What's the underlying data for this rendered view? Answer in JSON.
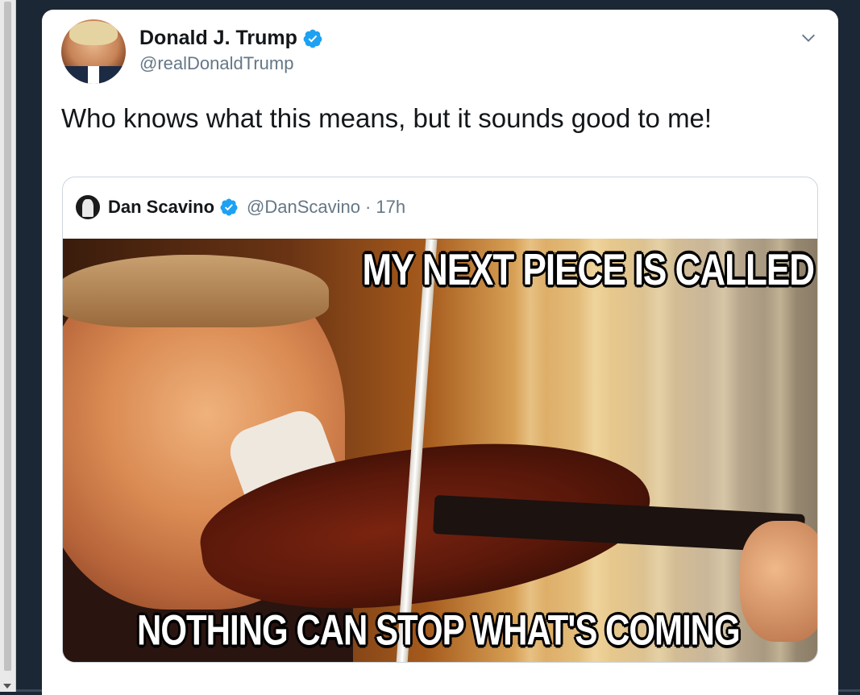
{
  "tweet": {
    "author_name": "Donald J. Trump",
    "author_handle": "@realDonaldTrump",
    "text": "Who knows what this means, but it sounds good to me!",
    "verified_color": "#1da1f2"
  },
  "quoted_tweet": {
    "author_name": "Dan Scavino",
    "author_handle": "@DanScavino",
    "separator": "·",
    "time": "17h",
    "image": {
      "caption_top": "MY NEXT PIECE IS CALLED",
      "caption_bottom": "NOTHING CAN STOP WHAT'S COMING"
    }
  },
  "icons": {
    "menu": "chevron-down-icon",
    "verified": "verified-badge-icon"
  }
}
